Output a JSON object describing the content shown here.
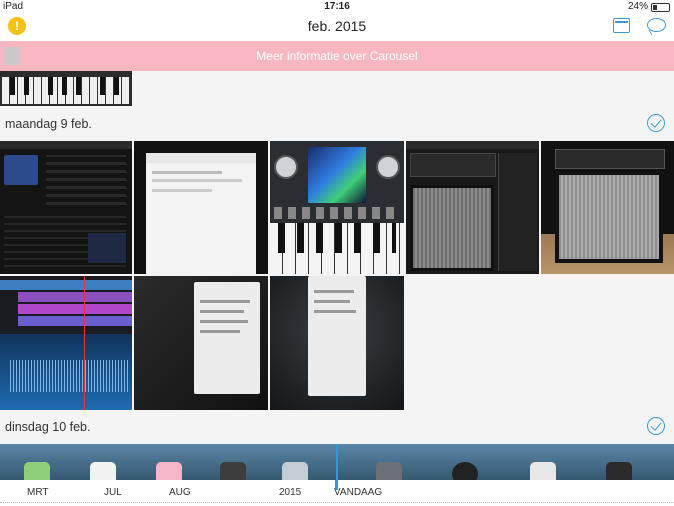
{
  "status_bar": {
    "carrier": "iPad",
    "time": "17:16",
    "battery": "24%"
  },
  "header": {
    "title": "feb. 2015",
    "badge": "!"
  },
  "banner": {
    "text": "Meer informatie over Carousel"
  },
  "days": [
    {
      "label": "maandag 9 feb."
    },
    {
      "label": "dinsdag 10 feb."
    }
  ],
  "timeline": {
    "labels": [
      "MRT",
      "JUL",
      "AUG",
      "2015",
      "VANDAAG"
    ]
  },
  "colors": {
    "accent": "#3a9ad9",
    "banner": "#f7b7c1",
    "badge": "#f3c117"
  }
}
